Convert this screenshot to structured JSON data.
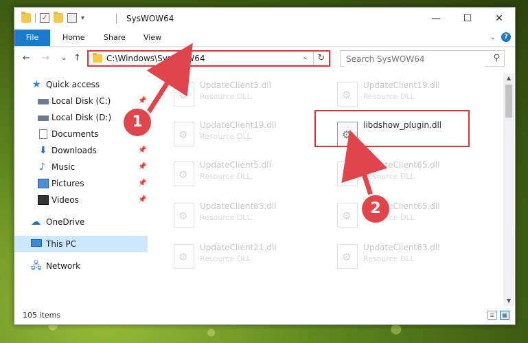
{
  "window": {
    "title": "SysWOW64"
  },
  "titlebar": {
    "min_glyph": "—",
    "max_glyph": "☐",
    "close_glyph": "✕",
    "dropdown_glyph": "▾"
  },
  "ribbon": {
    "tabs": [
      "File",
      "Home",
      "Share",
      "View"
    ],
    "expand_glyph": "⌄",
    "help_glyph": "?"
  },
  "nav": {
    "back_glyph": "←",
    "forward_glyph": "→",
    "recent_glyph": "⌄",
    "up_glyph": "↑",
    "address": "C:\\Windows\\SysWOW64",
    "address_dropdown_glyph": "⌄",
    "refresh_glyph": "↻",
    "search_placeholder": "Search SysWOW64",
    "search_glyph": "⚲"
  },
  "sidebar": {
    "items": [
      {
        "label": "Quick access",
        "icon": "star-icon",
        "pinned": false
      },
      {
        "label": "Local Disk (C:)",
        "icon": "drive-icon",
        "pinned": true
      },
      {
        "label": "Local Disk (D:)",
        "icon": "drive-icon",
        "pinned": false
      },
      {
        "label": "Documents",
        "icon": "documents-icon",
        "pinned": true
      },
      {
        "label": "Downloads",
        "icon": "downloads-icon",
        "pinned": true
      },
      {
        "label": "Music",
        "icon": "music-icon",
        "pinned": true
      },
      {
        "label": "Pictures",
        "icon": "pictures-icon",
        "pinned": true
      },
      {
        "label": "Videos",
        "icon": "videos-icon",
        "pinned": true
      },
      {
        "label": "OneDrive",
        "icon": "onedrive-icon",
        "pinned": false
      },
      {
        "label": "This PC",
        "icon": "this-pc-icon",
        "pinned": false,
        "selected": true
      },
      {
        "label": "Network",
        "icon": "network-icon",
        "pinned": false
      }
    ],
    "pin_glyph": "📌"
  },
  "files": [
    {
      "name": "UpdateClient5.dll",
      "type": "Resource DLL"
    },
    {
      "name": "UpdateClient19.dll",
      "type": "Resource DLL"
    },
    {
      "name": "UpdateClient19.dll",
      "type": "Resource DLL"
    },
    {
      "name": "libdshow_plugin.dll",
      "type": "",
      "highlighted": true
    },
    {
      "name": "UpdateClient5.dll",
      "type": "Resource DLL"
    },
    {
      "name": "UpdateClient65.dll",
      "type": "Resource DLL"
    },
    {
      "name": "UpdateClient65.dll",
      "type": "Resource DLL"
    },
    {
      "name": "UpdateClient65.dll",
      "type": "Resource DLL"
    },
    {
      "name": "UpdateClient21.dll",
      "type": "Resource DLL"
    },
    {
      "name": "UpdateClient63.dll",
      "type": "Resource DLL"
    }
  ],
  "status": {
    "item_count": "105 items"
  },
  "annotations": {
    "step1": "1",
    "step2": "2"
  },
  "colors": {
    "accent": "#1979ca",
    "highlight": "#d9363e",
    "annotation": "#e0454b"
  }
}
